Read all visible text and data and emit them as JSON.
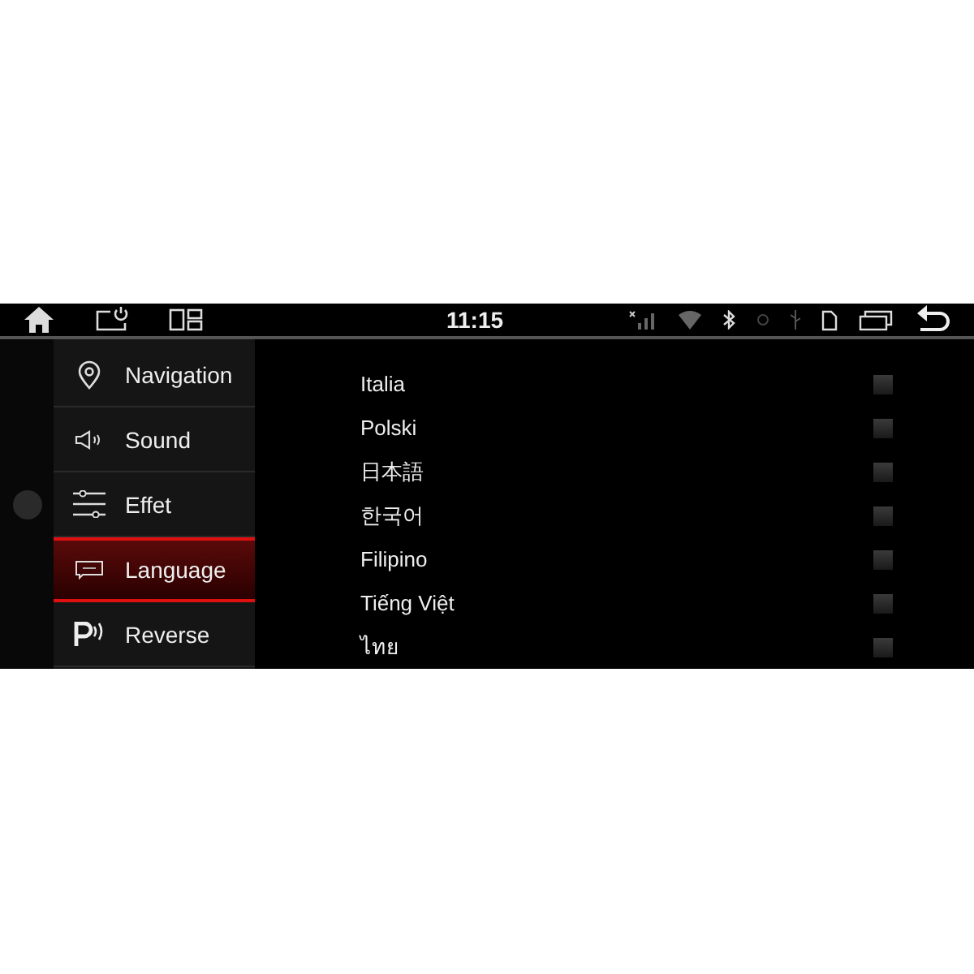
{
  "status_bar": {
    "time": "11:15"
  },
  "sidebar": {
    "items": [
      {
        "label": "Navigation",
        "kind": "pin",
        "selected": false
      },
      {
        "label": "Sound",
        "kind": "speaker",
        "selected": false
      },
      {
        "label": "Effet",
        "kind": "sliders",
        "selected": false
      },
      {
        "label": "Language",
        "kind": "abc",
        "selected": true
      },
      {
        "label": "Reverse",
        "kind": "parking",
        "selected": false
      }
    ]
  },
  "languages": [
    {
      "label": "Italia",
      "checked": false
    },
    {
      "label": "Polski",
      "checked": false
    },
    {
      "label": "日本語",
      "checked": false
    },
    {
      "label": "한국어",
      "checked": false
    },
    {
      "label": "Filipino",
      "checked": false
    },
    {
      "label": "Tiếng Việt",
      "checked": false
    },
    {
      "label": "ไทย",
      "checked": false
    }
  ]
}
